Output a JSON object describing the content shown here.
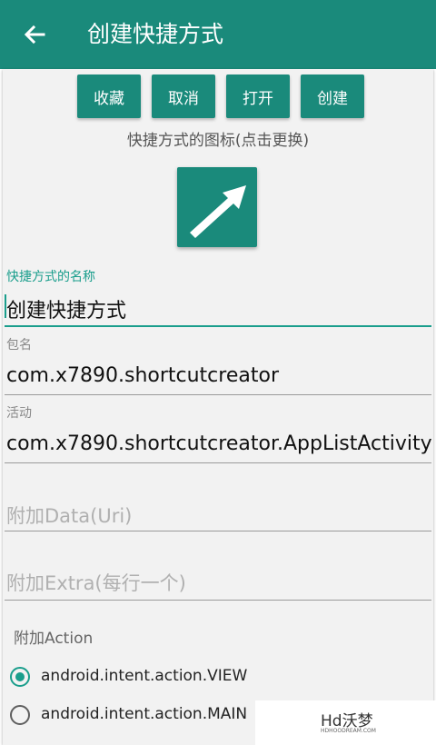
{
  "appbar": {
    "title": "创建快捷方式",
    "back_icon": "arrow-left-icon"
  },
  "buttons": {
    "favorite": "收藏",
    "cancel": "取消",
    "open": "打开",
    "create": "创建"
  },
  "icon_section": {
    "label": "快捷方式的图标(点击更换)",
    "icon": "arrow-up-right-icon"
  },
  "fields": {
    "name": {
      "label": "快捷方式的名称",
      "value": "创建快捷方式"
    },
    "package": {
      "label": "包名",
      "value": "com.x7890.shortcutcreator"
    },
    "activity": {
      "label": "活动",
      "value": "com.x7890.shortcutcreator.AppListActivity"
    },
    "data_uri": {
      "placeholder": "附加Data(Uri)"
    },
    "extra": {
      "placeholder": "附加Extra(每行一个)"
    }
  },
  "action_section": {
    "label": "附加Action",
    "options": [
      {
        "label": "android.intent.action.VIEW",
        "checked": true
      },
      {
        "label": "android.intent.action.MAIN",
        "checked": false
      }
    ]
  },
  "watermark": {
    "text": "Hd沃梦",
    "subtext": "HDHOODREAM.COM"
  },
  "colors": {
    "primary": "#1a8a7b",
    "accent": "#1a9e8c"
  }
}
